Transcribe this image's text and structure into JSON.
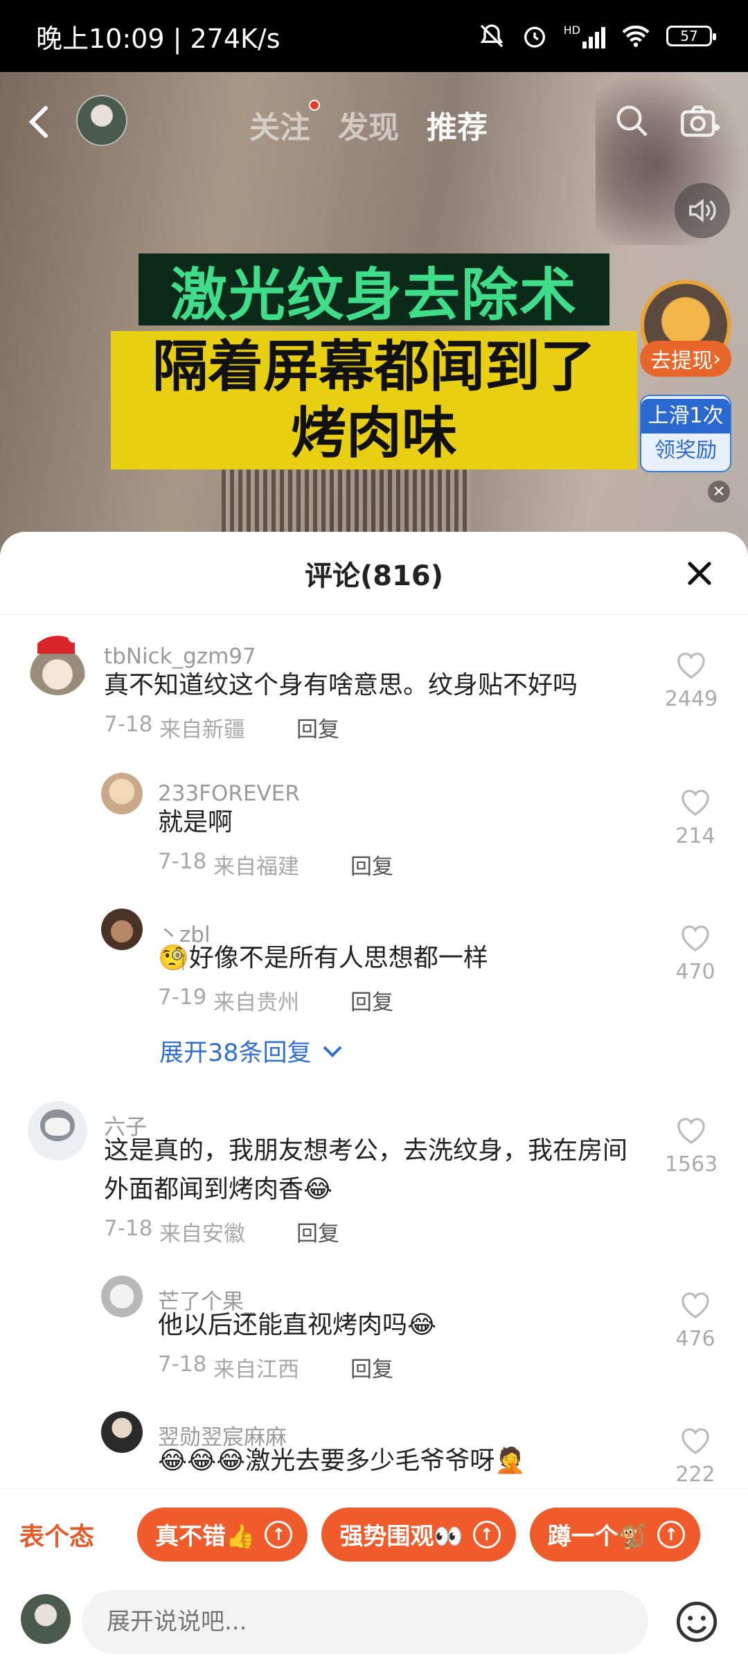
{
  "status_bar": {
    "time": "晚上10:09 | 274K/s",
    "network": "HD",
    "battery": "57"
  },
  "top_nav": {
    "tabs": [
      "关注",
      "发现",
      "推荐"
    ],
    "active_tab": "推荐"
  },
  "video": {
    "caption_line1": "激光纹身去除术",
    "caption_line2": "隔着屏幕都闻到了",
    "caption_line3": "烤肉味",
    "withdraw_label": "去提现",
    "swipe_label_top": "上滑1次",
    "swipe_label_bottom": "领奖励"
  },
  "comments_sheet": {
    "title": "评论(816)",
    "comments": [
      {
        "username": "tbNick_gzm97",
        "text": "真不知道纹这个身有啥意思。纹身贴不好吗",
        "date": "7-18",
        "location": "来自新疆",
        "reply_label": "回复",
        "likes": "2449"
      },
      {
        "username": "233FOREVER",
        "text": "就是啊",
        "date": "7-18",
        "location": "来自福建",
        "reply_label": "回复",
        "likes": "214"
      },
      {
        "username": "丶zbl",
        "text": "🧐好像不是所有人思想都一样",
        "date": "7-19",
        "location": "来自贵州",
        "reply_label": "回复",
        "likes": "470"
      },
      {
        "username": "六子",
        "text_line1": "这是真的，我朋友想考公，去洗纹身，我在房间",
        "text_line2": "外面都闻到烤肉香😂",
        "date": "7-18",
        "location": "来自安徽",
        "reply_label": "回复",
        "likes": "1563"
      },
      {
        "username": "芒了个果_",
        "text": "他以后还能直视烤肉吗😂",
        "date": "7-18",
        "location": "来自江西",
        "reply_label": "回复",
        "likes": "476"
      },
      {
        "username": "翌勋翌宸麻麻",
        "text": "😂😂😂激光去要多少毛爷爷呀🤦",
        "likes": "222"
      }
    ],
    "expand_replies": "展开38条回复"
  },
  "quick_reactions": {
    "label": "表个态",
    "chips": [
      "真不错👍",
      "强势围观👀",
      "蹲一个🐒"
    ]
  },
  "input_bar": {
    "placeholder": "展开说说吧..."
  },
  "colors": {
    "accent_orange": "#ef5b2a",
    "link_blue": "#2f6ed6"
  }
}
